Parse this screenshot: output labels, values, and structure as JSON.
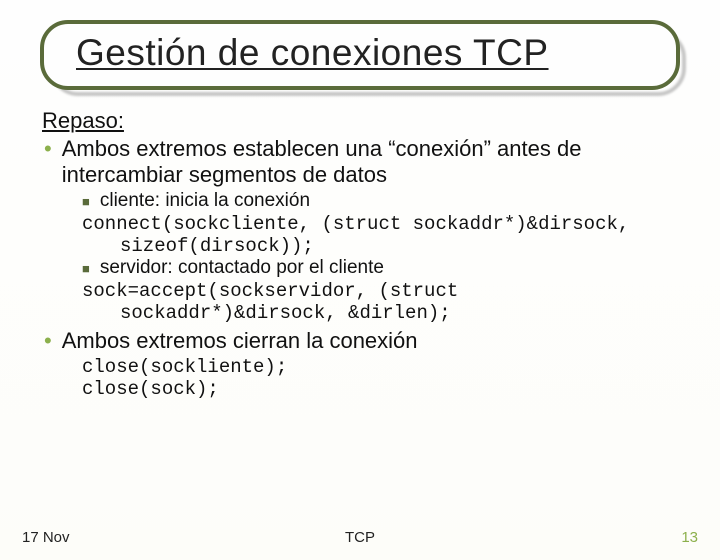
{
  "title": "Gestión de conexiones TCP",
  "repaso_label": "Repaso:",
  "bullet1": "Ambos extremos establecen una “conexión” antes de intercambiar segmentos de datos",
  "sub1": "cliente: inicia la conexión",
  "code1a": "connect(sockcliente, (struct sockaddr*)&dirsock,",
  "code1b": "sizeof(dirsock));",
  "sub2": "servidor: contactado por el cliente",
  "code2a": "sock=accept(sockservidor, (struct",
  "code2b": "sockaddr*)&dirsock, &dirlen);",
  "bullet2": "Ambos extremos cierran la conexión",
  "code3a": "close(sockliente);",
  "code3b": "close(sock);",
  "footer": {
    "left": "17 Nov",
    "center": "TCP",
    "right": "13"
  }
}
